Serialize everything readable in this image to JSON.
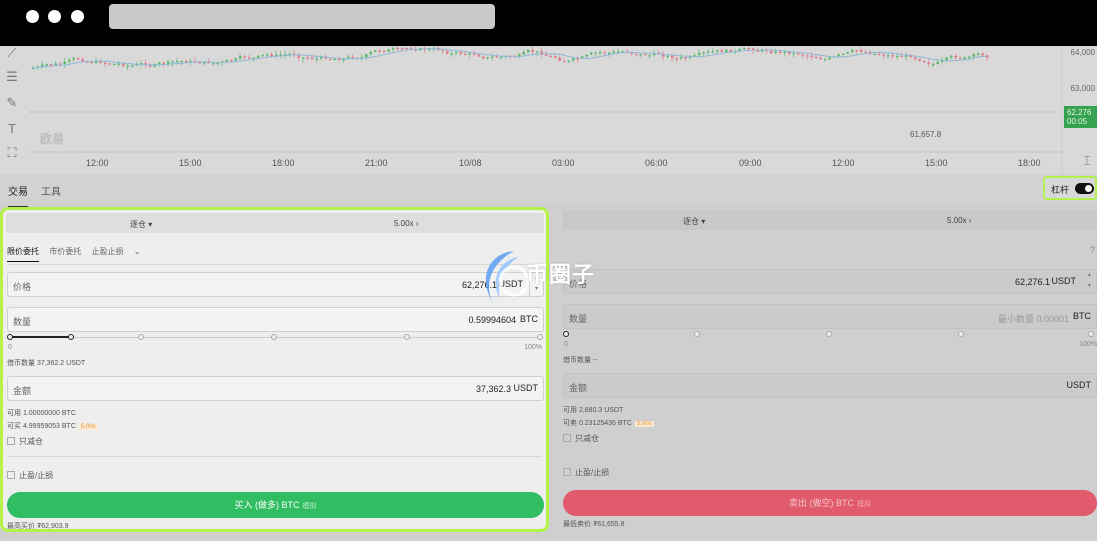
{
  "chart": {
    "x_ticks": [
      "12:00",
      "15:00",
      "18:00",
      "21:00",
      "10/08",
      "03:00",
      "06:00",
      "09:00",
      "12:00",
      "15:00",
      "18:00"
    ],
    "y_ticks": [
      "64,000",
      "63,000"
    ],
    "price_tag_line1": "62,276",
    "price_tag_line2": "00:05",
    "low_label": "61,657.8",
    "watermark": "欧易"
  },
  "tabs": {
    "trade": "交易",
    "tools": "工具"
  },
  "leverage_toggle": {
    "label": "杠杆",
    "on": true
  },
  "buy": {
    "margin_mode": "逐仓",
    "leverage": "5.00x",
    "order_tabs": [
      "限价委托",
      "市价委托",
      "止盈止损"
    ],
    "price_label": "价格",
    "price_value": "62,276.1",
    "price_unit": "USDT",
    "qty_label": "数量",
    "qty_value": "0.59994604",
    "qty_unit": "BTC",
    "slider_min": "0",
    "slider_max": "100%",
    "slider_fraction": 0.25,
    "borrow_text": "借币数量 37,362.2 USDT",
    "amount_label": "金额",
    "amount_value": "37,362.3",
    "amount_unit": "USDT",
    "available": "可用 1.00000000 BTC",
    "max_buy": "可买 4.99959053 BTC",
    "max_badge": "5.00x",
    "reduce_only": "只减仓",
    "tpsl": "止盈/止损",
    "button": "买入 (做多) BTC",
    "button_tag": "模拟",
    "best_price": "最高买价 ₮62,903.9"
  },
  "sell": {
    "margin_mode": "逐仓",
    "leverage": "5.00x",
    "price_label": "价格",
    "price_value": "62,276.1",
    "price_unit": "USDT",
    "qty_label": "数量",
    "qty_placeholder": "最小数量 0.00001",
    "qty_unit": "BTC",
    "slider_min": "0",
    "slider_max": "100%",
    "slider_fraction": 0,
    "borrow_text": "借币数量 --",
    "amount_label": "金额",
    "amount_unit": "USDT",
    "available": "可用 2,880.3 USDT",
    "max_sell": "可卖 0.23125436 BTC",
    "max_badge": "5.00x",
    "reduce_only": "只减仓",
    "tpsl": "止盈/止损",
    "button": "卖出 (做空) BTC",
    "button_tag": "模拟",
    "best_price": "最低卖价 ₮61,655.8"
  },
  "watermark": {
    "text": "币圈子"
  }
}
